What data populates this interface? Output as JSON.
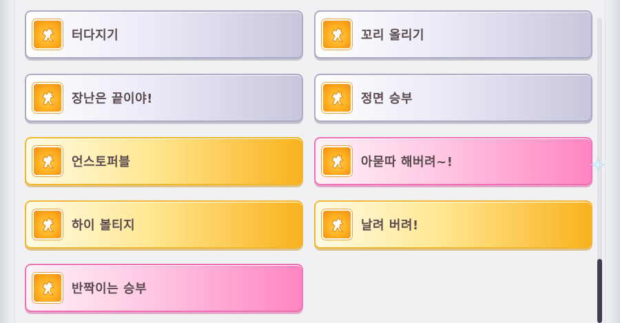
{
  "skills": [
    {
      "label": "터다지기",
      "style": "white",
      "icon": "horse-silhouette-icon"
    },
    {
      "label": "꼬리 올리기",
      "style": "white",
      "icon": "horse-silhouette-icon"
    },
    {
      "label": "장난은 끝이야!",
      "style": "white",
      "icon": "horse-silhouette-icon"
    },
    {
      "label": "정면 승부",
      "style": "white",
      "icon": "horse-silhouette-icon"
    },
    {
      "label": "언스토퍼블",
      "style": "gold",
      "icon": "horse-silhouette-icon"
    },
    {
      "label": "아묻따 해버려~!",
      "style": "pink",
      "icon": "horse-silhouette-icon"
    },
    {
      "label": "하이 볼티지",
      "style": "gold",
      "icon": "horse-silhouette-icon"
    },
    {
      "label": "날려 버려!",
      "style": "gold",
      "icon": "horse-silhouette-icon"
    },
    {
      "label": "반짝이는 승부",
      "style": "pink",
      "icon": "horse-silhouette-icon"
    }
  ],
  "colors": {
    "white_tier": "#ebeaf7",
    "gold_tier": "#f9b21e",
    "pink_tier": "#ff85c2",
    "label_text": "#5a4a4e"
  }
}
